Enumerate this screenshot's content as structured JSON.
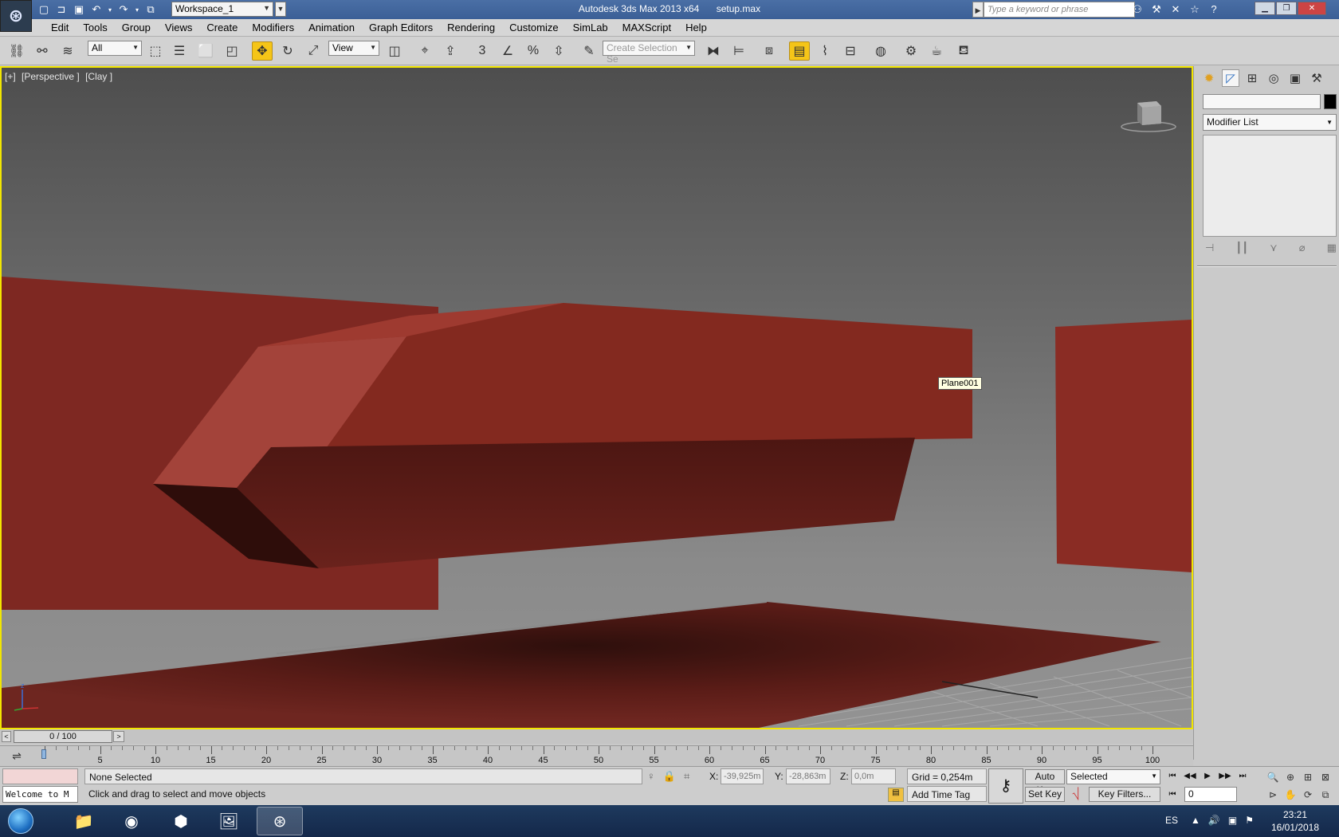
{
  "title_bar": {
    "app_name": "Autodesk 3ds Max  2013 x64",
    "file_name": "setup.max",
    "workspace": "Workspace_1",
    "search_placeholder": "Type a keyword or phrase",
    "quick_access_icons": [
      "new-file-icon",
      "open-file-icon",
      "save-icon",
      "undo-icon",
      "redo-icon",
      "project-folder-icon"
    ],
    "tool_icons": [
      "binoculars-icon",
      "wrench-icon",
      "exchange-icon",
      "star-icon",
      "help-icon"
    ]
  },
  "menu": {
    "items": [
      "Edit",
      "Tools",
      "Group",
      "Views",
      "Create",
      "Modifiers",
      "Animation",
      "Graph Editors",
      "Rendering",
      "Customize",
      "SimLab",
      "MAXScript",
      "Help"
    ]
  },
  "toolbar": {
    "selection_filter": "All",
    "reference_coord": "View",
    "selection_set_placeholder": "Create Selection Se",
    "snap_label": "3",
    "active_tool": "select-and-move"
  },
  "viewport": {
    "label_parts": [
      "[+]",
      "[Perspective ]",
      "[Clay ]"
    ],
    "tooltip": "Plane001",
    "axis_label": "z",
    "border_color": "#f2e600",
    "object_color": "#8a2a24"
  },
  "command_panel": {
    "modifier_list": "Modifier List",
    "object_name": "",
    "tabs": [
      "create-icon",
      "modify-icon",
      "hierarchy-icon",
      "motion-icon",
      "display-icon",
      "utilities-icon"
    ]
  },
  "time_slider": {
    "position": "0 / 100"
  },
  "trackbar": {
    "ticks": [
      "0",
      "5",
      "10",
      "15",
      "20",
      "25",
      "30",
      "35",
      "40",
      "45",
      "50",
      "55",
      "60",
      "65",
      "70",
      "75",
      "80",
      "85",
      "90",
      "95",
      "100"
    ]
  },
  "status": {
    "maxscript_text": "Welcome to M",
    "selection": "None Selected",
    "prompt": "Click and drag to select and move objects",
    "x_label": "X:",
    "x_value": "-39,925m",
    "y_label": "Y:",
    "y_value": "-28,863m",
    "z_label": "Z:",
    "z_value": "0,0m",
    "grid": "Grid = 0,254m",
    "add_time_tag": "Add Time Tag",
    "auto_key": "Auto Key",
    "set_key": "Set Key",
    "key_set_mode": "Selected",
    "key_filters": "Key Filters...",
    "current_frame": "0"
  },
  "taskbar": {
    "language": "ES",
    "time": "23:21",
    "date": "16/01/2018",
    "apps": [
      "file-explorer-icon",
      "firefox-icon",
      "3d-app-icon",
      "image-viewer-icon",
      "3ds-max-icon"
    ]
  }
}
